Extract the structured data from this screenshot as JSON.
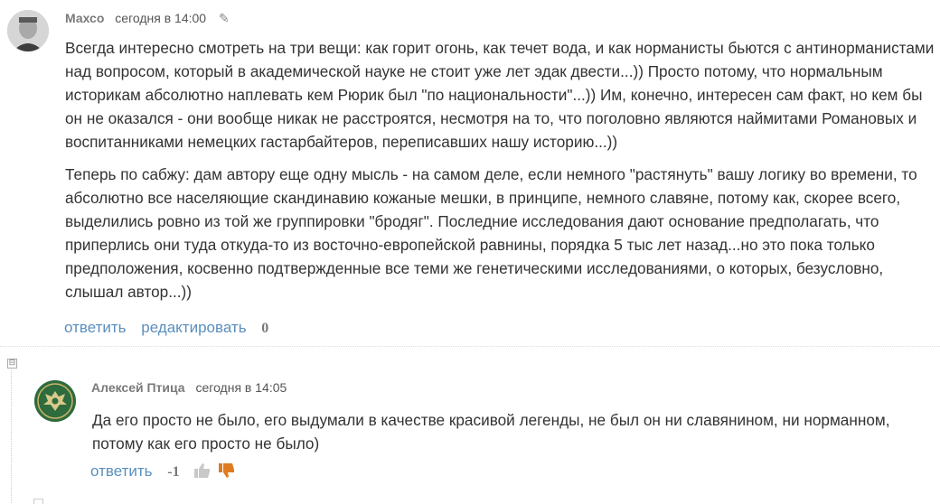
{
  "comments": [
    {
      "author": "Махсо",
      "time": "сегодня в 14:00",
      "avatar_icon": "user-photo-avatar",
      "paragraphs": [
        "Всегда интересно смотреть на три вещи: как горит огонь, как течет вода, и как норманисты бьются с антинорманистами над вопросом, который в академической науке не стоит уже лет эдак двести...)) Просто потому, что нормальным историкам абсолютно наплевать кем Рюрик был \"по национальности\"...)) Им, конечно, интересен сам факт, но кем бы он не оказался - они вообще никак не расстроятся, несмотря на то, что поголовно являются наймитами Романовых и воспитанниками немецких гастарбайтеров, переписавших нашу историю...))",
        "Теперь по сабжу: дам автору еще одну мысль - на самом деле, если немного \"растянуть\" вашу логику во времени, то абсолютно все населяющие скандинавию кожаные мешки, в принципе, немного славяне, потому как, скорее всего, выделились ровно из той же группировки \"бродяг\". Последние исследования дают основание предполагать, что приперлись они туда откуда-то из восточно-европейской равнины, порядка 5 тыс лет назад...но это пока только предположения, косвенно подтвержденные все теми же генетическими исследованиями, о которых, безусловно, слышал автор...))"
      ],
      "reply_label": "ответить",
      "edit_label": "редактировать",
      "score": "0"
    },
    {
      "author": "Алексей Птица",
      "time": "сегодня в 14:05",
      "avatar_icon": "eagle-emblem-avatar",
      "paragraphs": [
        "Да его просто не было, его выдумали в качестве красивой легенды, не был он ни славянином, ни норманном, потому как его просто не было)"
      ],
      "reply_label": "ответить",
      "score": "-1"
    }
  ],
  "collapse_symbol": "⊟",
  "colors": {
    "link": "#5b8fbd",
    "author": "#7a7a7a",
    "text": "#333333",
    "thumb_up": "#c8c8c8",
    "thumb_down": "#e07b1f"
  }
}
